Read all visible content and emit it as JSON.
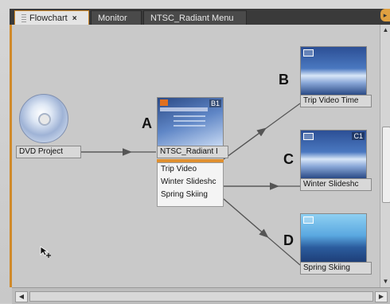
{
  "tabs": [
    {
      "label": "Flowchart",
      "close": "×",
      "active": true
    },
    {
      "label": "Monitor",
      "active": false
    },
    {
      "label": "NTSC_Radiant Menu",
      "active": false
    }
  ],
  "nodes": {
    "dvd_project": {
      "label": "DVD Project"
    },
    "menu": {
      "title": "NTSC_Radiant I",
      "badge": "B1",
      "buttons": [
        "Trip Video",
        "Winter Slideshc",
        "Spring Skiing"
      ]
    },
    "trip_video": {
      "label": "Trip Video Time"
    },
    "winter_slideshow": {
      "label": "Winter Slideshc",
      "badge": "C1"
    },
    "spring_skiing": {
      "label": "Spring Skiing"
    }
  },
  "callouts": {
    "a": "A",
    "b": "B",
    "c": "C",
    "d": "D"
  },
  "colors": {
    "accent": "#d08a2a",
    "panel": "#c9c9c9",
    "connector": "#555555"
  },
  "icons": {
    "disc": "dvd-disc-icon",
    "video": "video-clip-icon",
    "cursor": "move-cursor-icon"
  }
}
